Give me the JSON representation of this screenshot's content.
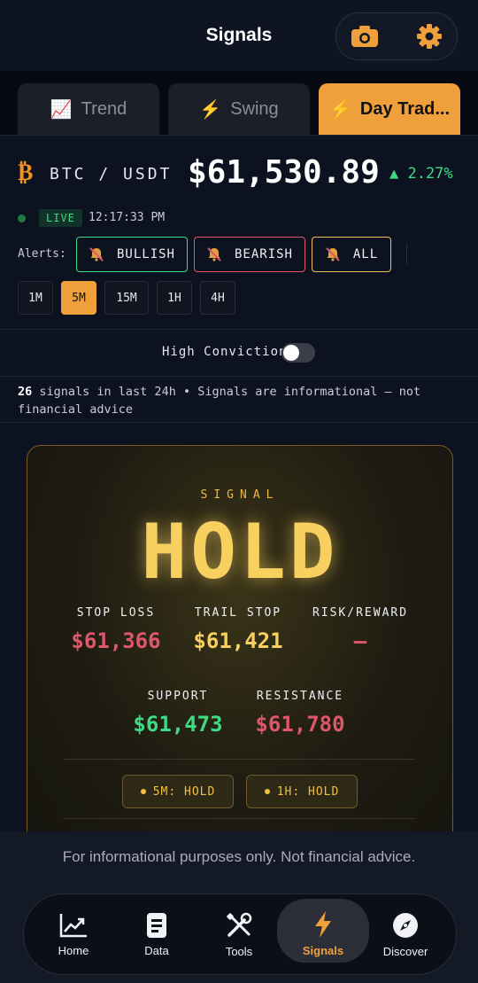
{
  "header": {
    "title": "Signals",
    "icons": [
      "camera-icon",
      "gear-icon"
    ]
  },
  "tabs": [
    {
      "label": "Trend",
      "icon": "📈",
      "active": false
    },
    {
      "label": "Swing",
      "icon": "⚡",
      "active": false
    },
    {
      "label": "Day Trad...",
      "icon": "⚡",
      "active": true
    }
  ],
  "ticker": {
    "symbol": "₿",
    "pair": "BTC / USDT",
    "price": "$61,530.89",
    "change": "▲ 2.27%",
    "live": "LIVE",
    "time": "12:17:33 PM"
  },
  "alerts": {
    "label": "Alerts:",
    "buttons": [
      {
        "label": "BULLISH",
        "color": "#3ddc84"
      },
      {
        "label": "BEARISH",
        "color": "#e0566a"
      },
      {
        "label": "ALL",
        "color": "#f0c060"
      }
    ]
  },
  "timeframes": {
    "items": [
      "1M",
      "5M",
      "15M",
      "1H",
      "4H"
    ],
    "active": "5M"
  },
  "conviction": {
    "label": "High Conviction",
    "enabled": false
  },
  "info": {
    "count": "26",
    "text": " signals in last 24h • Signals are informational — not financial advice"
  },
  "signal": {
    "label": "SIGNAL",
    "value": "HOLD",
    "stop_loss_label": "STOP LOSS",
    "stop_loss": "$61,366",
    "trail_stop_label": "TRAIL STOP",
    "trail_stop": "$61,421",
    "risk_reward_label": "RISK/REWARD",
    "risk_reward": "—",
    "support_label": "SUPPORT",
    "support": "$61,473",
    "resistance_label": "RESISTANCE",
    "resistance": "$61,780",
    "chips": [
      "5M: HOLD",
      "1H: HOLD"
    ]
  },
  "footer": {
    "disclaimer": "For informational purposes only. Not financial advice."
  },
  "nav": [
    {
      "label": "Home",
      "icon": "chart-up-icon"
    },
    {
      "label": "Data",
      "icon": "document-icon"
    },
    {
      "label": "Tools",
      "icon": "tools-icon"
    },
    {
      "label": "Signals",
      "icon": "bolt-icon",
      "active": true
    },
    {
      "label": "Discover",
      "icon": "compass-icon"
    }
  ],
  "colors": {
    "accent": "#f0a03a",
    "positive": "#3ddc84",
    "negative": "#e0566a",
    "signal": "#f7d060"
  }
}
